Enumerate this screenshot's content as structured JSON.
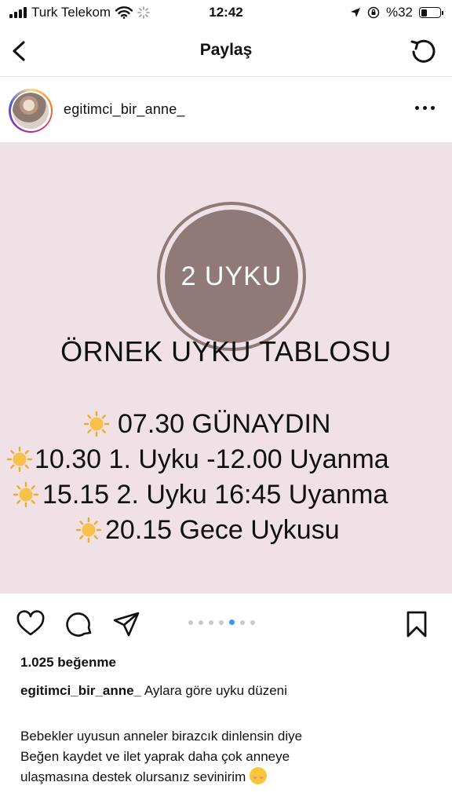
{
  "status_bar": {
    "carrier": "Turk Telekom",
    "time": "12:42",
    "battery": "%32",
    "battery_level": 0.32
  },
  "header": {
    "title": "Paylaş"
  },
  "post": {
    "username": "egitimci_bir_anne_",
    "image": {
      "badge": "2 UYKU",
      "title": "ÖRNEK UYKU TABLOSU",
      "schedule": [
        "07.30 GÜNAYDIN",
        "10.30 1. Uyku -12.00 Uyanma",
        "15.15 2. Uyku 16:45 Uyanma",
        "20.15 Gece Uykusu"
      ]
    },
    "carousel": {
      "count": 7,
      "active_index": 4
    },
    "likes": "1.025 beğenme",
    "caption_user": "egitimci_bir_anne_",
    "caption_text": "Aylara göre uyku düzeni",
    "body_lines": [
      "Bebekler uyusun anneler birazcık dinlensin diye",
      "Beğen kaydet  ve ilet yaprak daha çok anneye",
      "ulaşmasına destek olursanız sevinirim"
    ]
  },
  "icons": {
    "status": [
      "signal-icon",
      "wifi-icon",
      "loading-icon",
      "location-arrow-icon",
      "orientation-lock-icon",
      "battery-icon"
    ],
    "header": [
      "back-chevron-icon",
      "refresh-icon"
    ],
    "post_actions": [
      "heart-icon",
      "comment-icon",
      "share-icon",
      "bookmark-icon"
    ],
    "emoji": "smiling-face-with-hearts-icon"
  },
  "colors": {
    "post_background": "#efe1e5",
    "badge": "#8f7a78",
    "carousel_active": "#3897f0",
    "sun": "#f5b83a"
  }
}
